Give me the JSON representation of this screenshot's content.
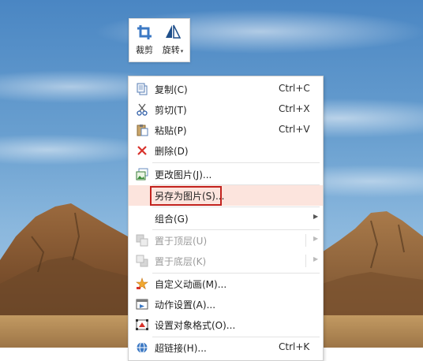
{
  "mini_toolbar": {
    "crop_label": "裁剪",
    "rotate_label": "旋转",
    "rotate_caret": "▾"
  },
  "context_menu": {
    "items": [
      {
        "label": "复制(C)",
        "shortcut": "Ctrl+C",
        "icon": "copy-icon"
      },
      {
        "label": "剪切(T)",
        "shortcut": "Ctrl+X",
        "icon": "scissors-icon"
      },
      {
        "label": "粘贴(P)",
        "shortcut": "Ctrl+V",
        "icon": "paste-icon"
      },
      {
        "label": "删除(D)",
        "shortcut": "",
        "icon": "delete-icon"
      },
      {
        "label": "更改图片(J)...",
        "shortcut": "",
        "icon": "change-picture-icon"
      },
      {
        "label": "另存为图片(S)...",
        "shortcut": "",
        "icon": "",
        "highlighted": true
      },
      {
        "label": "组合(G)",
        "shortcut": "",
        "icon": "",
        "submenu_arrow": "▶"
      },
      {
        "label": "置于顶层(U)",
        "shortcut": "",
        "icon": "bring-to-front-icon",
        "disabled": true,
        "submenu_arrow": "▶"
      },
      {
        "label": "置于底层(K)",
        "shortcut": "",
        "icon": "send-to-back-icon",
        "disabled": true,
        "submenu_arrow": "▶"
      },
      {
        "label": "自定义动画(M)...",
        "shortcut": "",
        "icon": "custom-animation-icon"
      },
      {
        "label": "动作设置(A)...",
        "shortcut": "",
        "icon": "action-settings-icon"
      },
      {
        "label": "设置对象格式(O)...",
        "shortcut": "",
        "icon": "format-object-icon"
      },
      {
        "label": "超链接(H)...",
        "shortcut": "Ctrl+K",
        "icon": "hyperlink-icon"
      }
    ],
    "highlight_color": "#fce4dd",
    "annotation_box_color": "#c2231e"
  }
}
